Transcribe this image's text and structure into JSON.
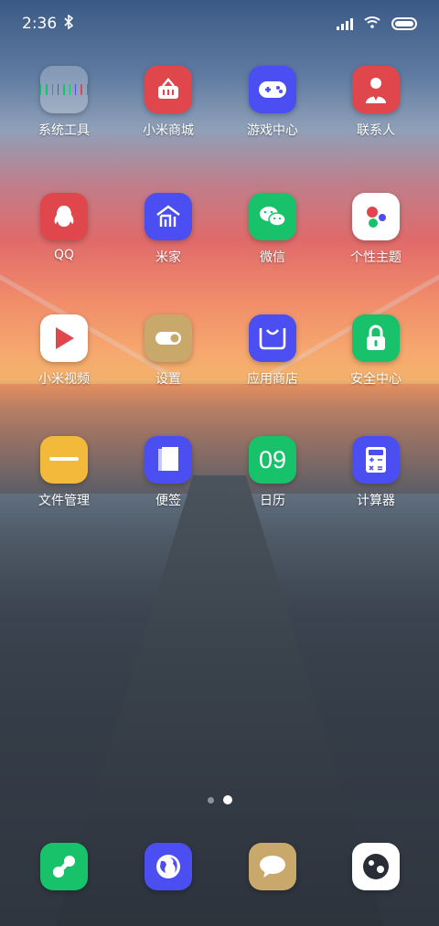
{
  "status_bar": {
    "time": "2:36",
    "bluetooth_icon": "bluetooth-icon",
    "signal_icon": "signal-icon",
    "wifi_icon": "wifi-icon",
    "battery_icon": "battery-icon"
  },
  "home": {
    "rows": [
      [
        {
          "label": "系统工具",
          "icon": "folder-icon",
          "color": "rgba(255,255,255,0.25)"
        },
        {
          "label": "小米商城",
          "icon": "basket-icon",
          "color": "#e0474c"
        },
        {
          "label": "游戏中心",
          "icon": "gamepad-icon",
          "color": "#4b4ef0"
        },
        {
          "label": "联系人",
          "icon": "contact-icon",
          "color": "#e0474c"
        }
      ],
      [
        {
          "label": "QQ",
          "icon": "penguin-icon",
          "color": "#e0474c"
        },
        {
          "label": "米家",
          "icon": "mi-home-icon",
          "color": "#4b4ef0"
        },
        {
          "label": "微信",
          "icon": "wechat-icon",
          "color": "#18c26a"
        },
        {
          "label": "个性主题",
          "icon": "themes-icon",
          "color": "#ffffff"
        }
      ],
      [
        {
          "label": "小米视频",
          "icon": "play-icon",
          "color": "#ffffff"
        },
        {
          "label": "设置",
          "icon": "toggle-icon",
          "color": "#c9a86b"
        },
        {
          "label": "应用商店",
          "icon": "bag-icon",
          "color": "#4b4ef0"
        },
        {
          "label": "安全中心",
          "icon": "lock-icon",
          "color": "#18c26a"
        }
      ],
      [
        {
          "label": "文件管理",
          "icon": "folder-file-icon",
          "color": "#f2b93b"
        },
        {
          "label": "便签",
          "icon": "notes-icon",
          "color": "#4b4ef0"
        },
        {
          "label": "日历",
          "icon": "calendar-icon",
          "color": "#18c26a",
          "text": "09"
        },
        {
          "label": "计算器",
          "icon": "calculator-icon",
          "color": "#4b4ef0"
        }
      ]
    ]
  },
  "page_indicator": {
    "pages": 2,
    "current": 2
  },
  "dock": [
    {
      "icon": "phone-link-icon",
      "color": "#18c26a"
    },
    {
      "icon": "globe-icon",
      "color": "#4b4ef0"
    },
    {
      "icon": "message-icon",
      "color": "#c9a86b"
    },
    {
      "icon": "camera-icon",
      "color": "#ffffff"
    }
  ]
}
